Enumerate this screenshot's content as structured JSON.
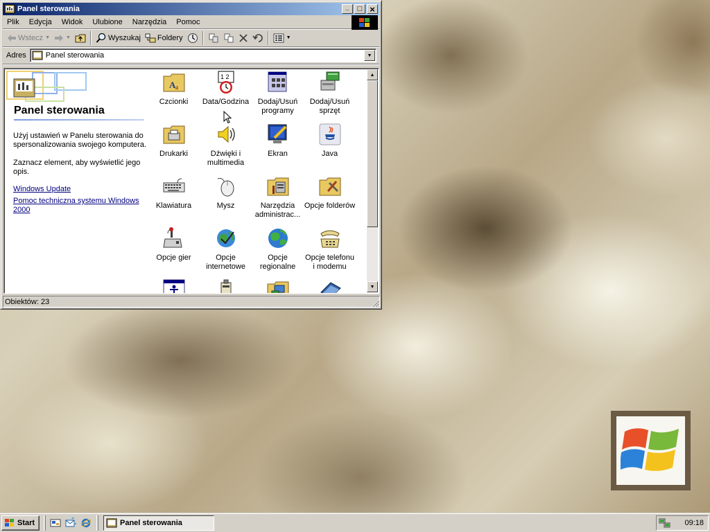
{
  "window": {
    "title": "Panel sterowania",
    "controls": {
      "minimize": "_",
      "maximize": "□",
      "close": "×"
    }
  },
  "menu": [
    "Plik",
    "Edycja",
    "Widok",
    "Ulubione",
    "Narzędzia",
    "Pomoc"
  ],
  "toolbar": {
    "back": "Wstecz",
    "search": "Wyszukaj",
    "folders": "Foldery"
  },
  "address": {
    "label": "Adres",
    "value": "Panel sterowania"
  },
  "left_pane": {
    "title": "Panel sterowania",
    "description": "Użyj ustawień w Panelu sterowania do spersonalizowania swojego komputera.",
    "hint": "Zaznacz element, aby wyświetlić jego opis.",
    "links": [
      "Windows Update",
      "Pomoc techniczna systemu Windows 2000"
    ]
  },
  "items": [
    {
      "label": "Czcionki",
      "icon": "fonts-folder-icon"
    },
    {
      "label": "Data/Godzina",
      "icon": "date-time-icon"
    },
    {
      "label": "Dodaj/Usuń programy",
      "icon": "add-remove-programs-icon"
    },
    {
      "label": "Dodaj/Usuń sprzęt",
      "icon": "add-hardware-icon"
    },
    {
      "label": "Drukarki",
      "icon": "printers-folder-icon"
    },
    {
      "label": "Dźwięki i multimedia",
      "icon": "sounds-multimedia-icon"
    },
    {
      "label": "Ekran",
      "icon": "display-icon"
    },
    {
      "label": "Java",
      "icon": "java-icon"
    },
    {
      "label": "Klawiatura",
      "icon": "keyboard-icon"
    },
    {
      "label": "Mysz",
      "icon": "mouse-icon"
    },
    {
      "label": "Narzędzia administrac...",
      "icon": "admin-tools-folder-icon"
    },
    {
      "label": "Opcje folderów",
      "icon": "folder-options-icon"
    },
    {
      "label": "Opcje gier",
      "icon": "game-controllers-icon"
    },
    {
      "label": "Opcje internetowe",
      "icon": "internet-options-icon"
    },
    {
      "label": "Opcje regionalne",
      "icon": "regional-options-icon"
    },
    {
      "label": "Opcje telefonu i modemu",
      "icon": "phone-modem-icon"
    },
    {
      "label": "",
      "icon": "accessibility-icon"
    },
    {
      "label": "",
      "icon": "power-options-icon"
    },
    {
      "label": "",
      "icon": "network-folder-icon"
    },
    {
      "label": "",
      "icon": "scanners-cameras-icon"
    }
  ],
  "status": {
    "text": "Obiektów: 23"
  },
  "taskbar": {
    "start": "Start",
    "task": "Panel sterowania",
    "clock": "09:18"
  }
}
